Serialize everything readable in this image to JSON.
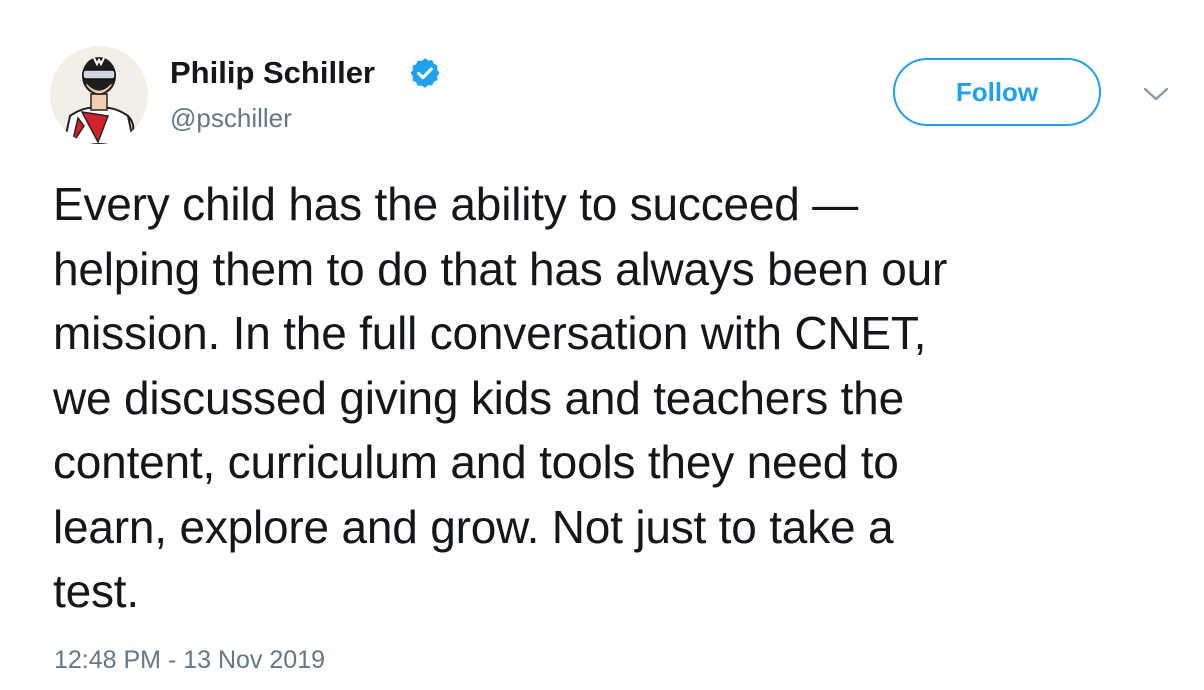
{
  "author": {
    "name": "Philip Schiller",
    "handle": "@pschiller",
    "verified": true
  },
  "follow": {
    "label": "Follow"
  },
  "icons": {
    "avatar": "avatar-illustration",
    "verified": "verified-badge-icon",
    "menu": "chevron-down-icon"
  },
  "tweet": {
    "lines": [
      "Every child has the ability to succeed —",
      "helping them to do that has always been our",
      "mission. In the full conversation with CNET,",
      "we discussed giving kids and teachers the",
      "content, curriculum and tools they need to",
      "learn, explore and grow. Not just to take a",
      "test."
    ]
  },
  "timestamp": "12:48 PM - 13 Nov 2019",
  "colors": {
    "accent": "#1da1f2",
    "text": "#14171a",
    "secondary": "#657786"
  }
}
